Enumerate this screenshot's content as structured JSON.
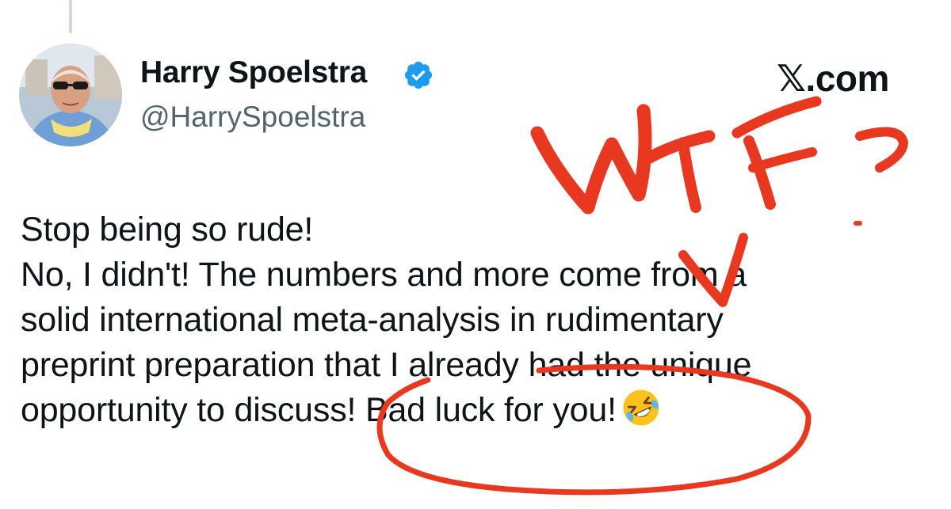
{
  "author": {
    "display_name": "Harry Spoelstra",
    "handle": "@HarrySpoelstra",
    "verified": true
  },
  "site_logo": "𝕏.com",
  "tweet": {
    "lines": [
      "Stop being so rude!",
      "No, I didn't! The numbers and more come from a",
      "solid international meta-analysis in rudimentary",
      "preprint preparation that I already had the unique",
      "opportunity to discuss! Bad luck for you!"
    ],
    "emoji": "rolling-on-floor-laughing-emoji"
  },
  "annotation": {
    "text": "WTF ?",
    "color": "#e8381f"
  },
  "colors": {
    "verified": "#1d9bf0",
    "secondary_text": "#536471",
    "primary_text": "#0f1419"
  }
}
